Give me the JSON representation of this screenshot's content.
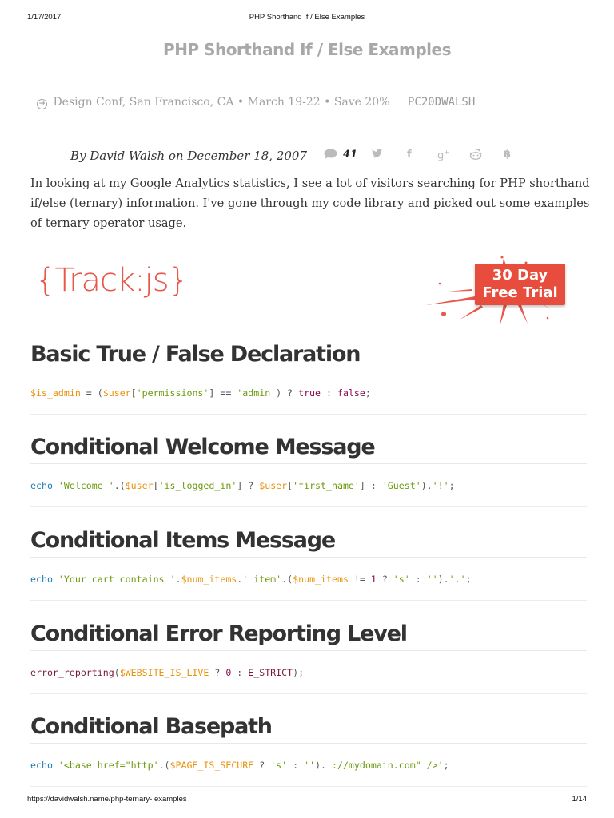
{
  "print_header": {
    "date": "1/17/2017",
    "title": "PHP Shorthand If / Else Examples"
  },
  "page_title": "PHP Shorthand If / Else Examples",
  "promo": {
    "icon": "circle-arrow-right-icon",
    "text": "Design Conf, San Francisco, CA • March 19-22 • Save 20%",
    "code": "PC20DWALSH"
  },
  "byline": {
    "prefix": "By",
    "author": "David Walsh",
    "middle": "on",
    "date": "December 18, 2007"
  },
  "share": {
    "comment_icon": "comment-icon",
    "comment_count": "41",
    "icons": [
      "twitter-icon",
      "facebook-icon",
      "google-plus-icon",
      "reddit-icon",
      "bitcoin-icon"
    ]
  },
  "intro": "In looking at my Google Analytics statistics, I see a lot of visitors searching for PHP shorthand if/else (ternary) information. I've gone through my code library and picked out some examples of ternary operator usage.",
  "ad": {
    "logo": "{Track:js}",
    "badge_line1": "30 Day",
    "badge_line2": "Free Trial",
    "brand_color": "#e74c3c"
  },
  "sections": [
    {
      "heading": "Basic True / False Declaration",
      "code": [
        {
          "t": "$is_admin",
          "c": "var"
        },
        {
          "t": " = (",
          "c": "op"
        },
        {
          "t": "$user",
          "c": "var"
        },
        {
          "t": "[",
          "c": "op"
        },
        {
          "t": "'permissions'",
          "c": "str"
        },
        {
          "t": "] == ",
          "c": "op"
        },
        {
          "t": "'admin'",
          "c": "str"
        },
        {
          "t": ") ? ",
          "c": "op"
        },
        {
          "t": "true",
          "c": "const"
        },
        {
          "t": " : ",
          "c": "op"
        },
        {
          "t": "false",
          "c": "const"
        },
        {
          "t": ";",
          "c": "op"
        }
      ]
    },
    {
      "heading": "Conditional Welcome Message",
      "code": [
        {
          "t": "echo",
          "c": "kw"
        },
        {
          "t": " ",
          "c": "op"
        },
        {
          "t": "'Welcome '",
          "c": "str"
        },
        {
          "t": ".(",
          "c": "op"
        },
        {
          "t": "$user",
          "c": "var"
        },
        {
          "t": "[",
          "c": "op"
        },
        {
          "t": "'is_logged_in'",
          "c": "str"
        },
        {
          "t": "] ? ",
          "c": "op"
        },
        {
          "t": "$user",
          "c": "var"
        },
        {
          "t": "[",
          "c": "op"
        },
        {
          "t": "'first_name'",
          "c": "str"
        },
        {
          "t": "] : ",
          "c": "op"
        },
        {
          "t": "'Guest'",
          "c": "str"
        },
        {
          "t": ").",
          "c": "op"
        },
        {
          "t": "'!'",
          "c": "str"
        },
        {
          "t": ";",
          "c": "op"
        }
      ]
    },
    {
      "heading": "Conditional Items Message",
      "code": [
        {
          "t": "echo",
          "c": "kw"
        },
        {
          "t": " ",
          "c": "op"
        },
        {
          "t": "'Your cart contains '",
          "c": "str"
        },
        {
          "t": ".",
          "c": "op"
        },
        {
          "t": "$num_items",
          "c": "var"
        },
        {
          "t": ".",
          "c": "op"
        },
        {
          "t": "' item'",
          "c": "str"
        },
        {
          "t": ".(",
          "c": "op"
        },
        {
          "t": "$num_items",
          "c": "var"
        },
        {
          "t": " != ",
          "c": "op"
        },
        {
          "t": "1",
          "c": "const"
        },
        {
          "t": " ? ",
          "c": "op"
        },
        {
          "t": "'s'",
          "c": "str"
        },
        {
          "t": " : ",
          "c": "op"
        },
        {
          "t": "''",
          "c": "str"
        },
        {
          "t": ").",
          "c": "op"
        },
        {
          "t": "'.'",
          "c": "str"
        },
        {
          "t": ";",
          "c": "op"
        }
      ]
    },
    {
      "heading": "Conditional Error Reporting Level",
      "code": [
        {
          "t": "error_reporting",
          "c": "func"
        },
        {
          "t": "(",
          "c": "op"
        },
        {
          "t": "$WEBSITE_IS_LIVE",
          "c": "var"
        },
        {
          "t": " ? ",
          "c": "op"
        },
        {
          "t": "0",
          "c": "const"
        },
        {
          "t": " : ",
          "c": "op"
        },
        {
          "t": "E_STRICT",
          "c": "func"
        },
        {
          "t": ");",
          "c": "op"
        }
      ]
    },
    {
      "heading": "Conditional Basepath",
      "code": [
        {
          "t": "echo",
          "c": "kw"
        },
        {
          "t": " ",
          "c": "op"
        },
        {
          "t": "'<base href=\"http'",
          "c": "str"
        },
        {
          "t": ".(",
          "c": "op"
        },
        {
          "t": "$PAGE_IS_SECURE",
          "c": "var"
        },
        {
          "t": " ? ",
          "c": "op"
        },
        {
          "t": "'s'",
          "c": "str"
        },
        {
          "t": " : ",
          "c": "op"
        },
        {
          "t": "''",
          "c": "str"
        },
        {
          "t": ").",
          "c": "op"
        },
        {
          "t": "'://mydomain.com\" />'",
          "c": "str"
        },
        {
          "t": ";",
          "c": "op"
        }
      ]
    }
  ],
  "print_footer": {
    "url": "https://davidwalsh.name/php-ternary- examples",
    "page": "1/14"
  }
}
